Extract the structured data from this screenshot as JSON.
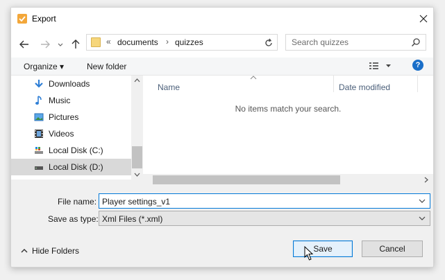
{
  "window": {
    "title": "Export"
  },
  "address": {
    "prefix": "«",
    "crumbs": [
      "documents",
      "quizzes"
    ],
    "sep": "›"
  },
  "search": {
    "placeholder": "Search quizzes"
  },
  "toolbar": {
    "organize": "Organize ▾",
    "new_folder": "New folder"
  },
  "nav_pane": {
    "items": [
      {
        "label": "Downloads",
        "icon": "download-icon"
      },
      {
        "label": "Music",
        "icon": "music-icon"
      },
      {
        "label": "Pictures",
        "icon": "pictures-icon"
      },
      {
        "label": "Videos",
        "icon": "videos-icon"
      },
      {
        "label": "Local Disk (C:)",
        "icon": "drive-icon"
      },
      {
        "label": "Local Disk (D:)",
        "icon": "drive-icon",
        "selected": true
      }
    ]
  },
  "file_list": {
    "columns": [
      "Name",
      "Date modified"
    ],
    "empty_message": "No items match your search."
  },
  "form": {
    "file_name_label": "File name:",
    "file_name_value": "Player settings_v1",
    "save_as_label": "Save as type:",
    "save_as_value": "Xml Files (*.xml)"
  },
  "footer": {
    "hide_folders": "Hide Folders",
    "save": "Save",
    "cancel": "Cancel"
  },
  "colors": {
    "accent": "#0078d7",
    "folder": "#f6d67b",
    "help": "#1a6fc9"
  }
}
